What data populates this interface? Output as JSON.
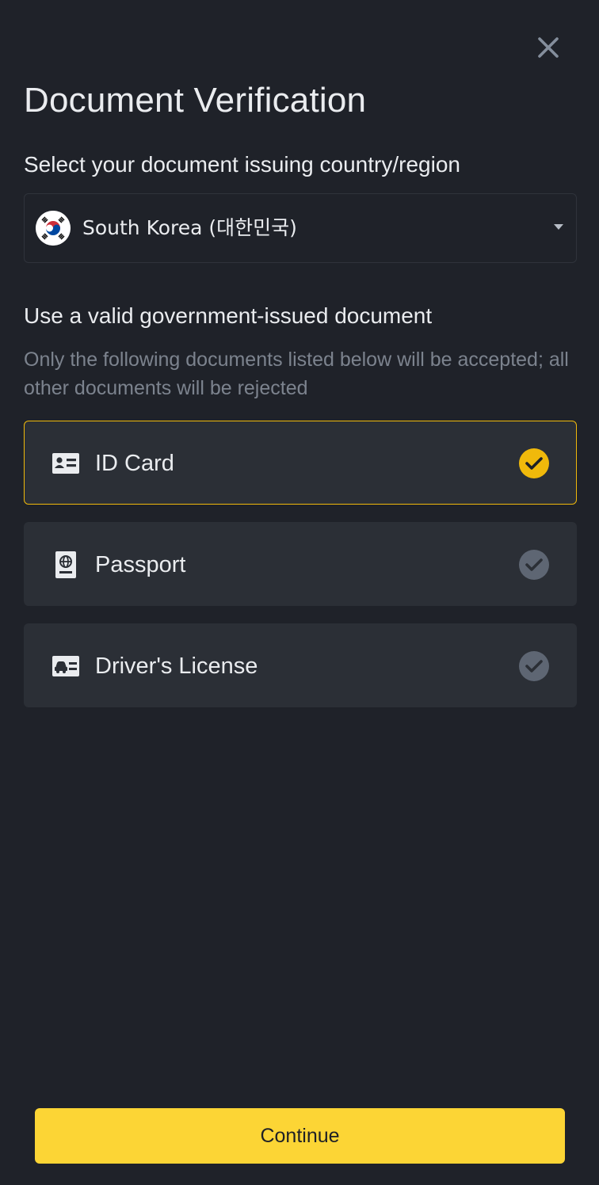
{
  "header": {
    "title": "Document Verification",
    "close_icon": "close-icon"
  },
  "country": {
    "label": "Select your document issuing country/region",
    "selected": "South Korea (대한민국)",
    "flag_icon": "south-korea-flag-icon"
  },
  "documents": {
    "heading": "Use a valid government-issued document",
    "note": "Only the following documents listed below will be accepted; all other documents will be rejected",
    "selected_index": 0,
    "options": [
      {
        "label": "ID Card",
        "icon": "id-card-icon",
        "selected": true
      },
      {
        "label": "Passport",
        "icon": "passport-icon",
        "selected": false
      },
      {
        "label": "Driver's License",
        "icon": "drivers-license-icon",
        "selected": false
      }
    ]
  },
  "footer": {
    "continue_label": "Continue"
  },
  "colors": {
    "background": "#1f2229",
    "card": "#2b2f36",
    "accent": "#f0b90b",
    "button": "#fcd535",
    "check_selected": "#f0b90b",
    "check_unselected": "#5e6673"
  }
}
